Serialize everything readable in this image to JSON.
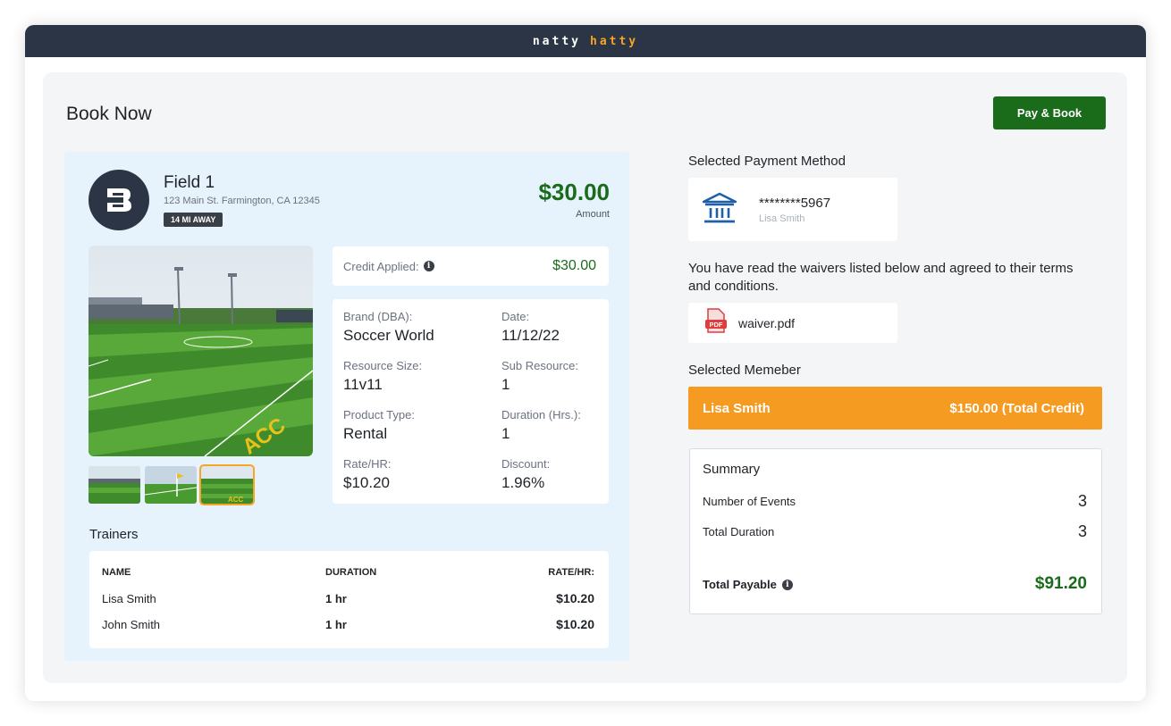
{
  "app": {
    "brand_part1": "natty",
    "brand_part2": "hatty"
  },
  "page": {
    "title": "Book Now",
    "pay_button": "Pay & Book"
  },
  "field": {
    "name": "Field 1",
    "address": "123 Main St. Farmington, CA 12345",
    "distance_badge": "14 MI AWAY",
    "amount": "$30.00",
    "amount_label": "Amount"
  },
  "gallery": {
    "thumbnail_count": 3,
    "active_index": 2
  },
  "credit": {
    "label": "Credit Applied:",
    "value": "$30.00"
  },
  "details": [
    {
      "label": "Brand (DBA):",
      "value": "Soccer World"
    },
    {
      "label": "Date:",
      "value": "11/12/22"
    },
    {
      "label": "Resource Size:",
      "value": "11v11"
    },
    {
      "label": "Sub Resource:",
      "value": "1"
    },
    {
      "label": "Product Type:",
      "value": "Rental"
    },
    {
      "label": "Duration (Hrs.):",
      "value": "1"
    },
    {
      "label": "Rate/HR:",
      "value": "$10.20"
    },
    {
      "label": "Discount:",
      "value": "1.96%"
    }
  ],
  "trainers": {
    "title": "Trainers",
    "columns": [
      "NAME",
      "DURATION",
      "RATE/HR:"
    ],
    "rows": [
      {
        "name": "Lisa Smith",
        "duration": "1 hr",
        "rate": "$10.20"
      },
      {
        "name": "John Smith",
        "duration": "1 hr",
        "rate": "$10.20"
      }
    ]
  },
  "payment": {
    "section_title": "Selected Payment Method",
    "card_number": "********5967",
    "card_holder": "Lisa Smith"
  },
  "waiver": {
    "text": "You have read the waivers listed below and agreed to their terms and conditions.",
    "file_name": "waiver.pdf",
    "file_icon_text": "PDF"
  },
  "member": {
    "section_title": "Selected Memeber",
    "name": "Lisa Smith",
    "credit": "$150.00 (Total Credit)"
  },
  "summary": {
    "title": "Summary",
    "rows": [
      {
        "label": "Number of Events",
        "value": "3"
      },
      {
        "label": "Total Duration",
        "value": "3"
      }
    ],
    "total_label": "Total Payable",
    "total_value": "$91.20"
  },
  "colors": {
    "accent_green": "#1a6b1a",
    "accent_orange": "#f59b22",
    "header_dark": "#2b3545",
    "card_blue": "#e6f2fc"
  }
}
